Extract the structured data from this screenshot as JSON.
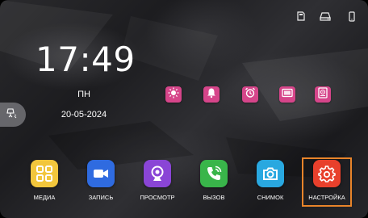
{
  "status_bar": {
    "icons": [
      "sd-card-icon",
      "network-drive-icon",
      "phone-icon"
    ]
  },
  "clock": {
    "time": "17:49",
    "weekday": "ПН",
    "date": "20-05-2024"
  },
  "side_button": {
    "icon": "wall-lamp-icon"
  },
  "modes": [
    {
      "icon": "sun-icon"
    },
    {
      "icon": "bell-icon"
    },
    {
      "icon": "alarm-clock-icon"
    },
    {
      "icon": "screen-icon"
    },
    {
      "icon": "storage-icon"
    }
  ],
  "colors": {
    "mode_tile": "#d6458a",
    "selection_border": "#e8842a",
    "media": "#f2c63c",
    "record": "#2f6be0",
    "view": "#8a45d6",
    "call": "#39b54a",
    "snapshot": "#29a8e0",
    "settings": "#e8402c"
  },
  "dock": [
    {
      "label": "МЕДИА",
      "icon": "grid-icon"
    },
    {
      "label": "ЗАПИСЬ",
      "icon": "video-camera-icon"
    },
    {
      "label": "ПРОСМОТР",
      "icon": "webcam-icon"
    },
    {
      "label": "ВЫЗОВ",
      "icon": "phone-ringing-icon"
    },
    {
      "label": "СНИМОК",
      "icon": "camera-icon"
    },
    {
      "label": "НАСТРОЙКА",
      "icon": "gear-icon"
    }
  ],
  "selected_item": "НАСТРОЙКА"
}
